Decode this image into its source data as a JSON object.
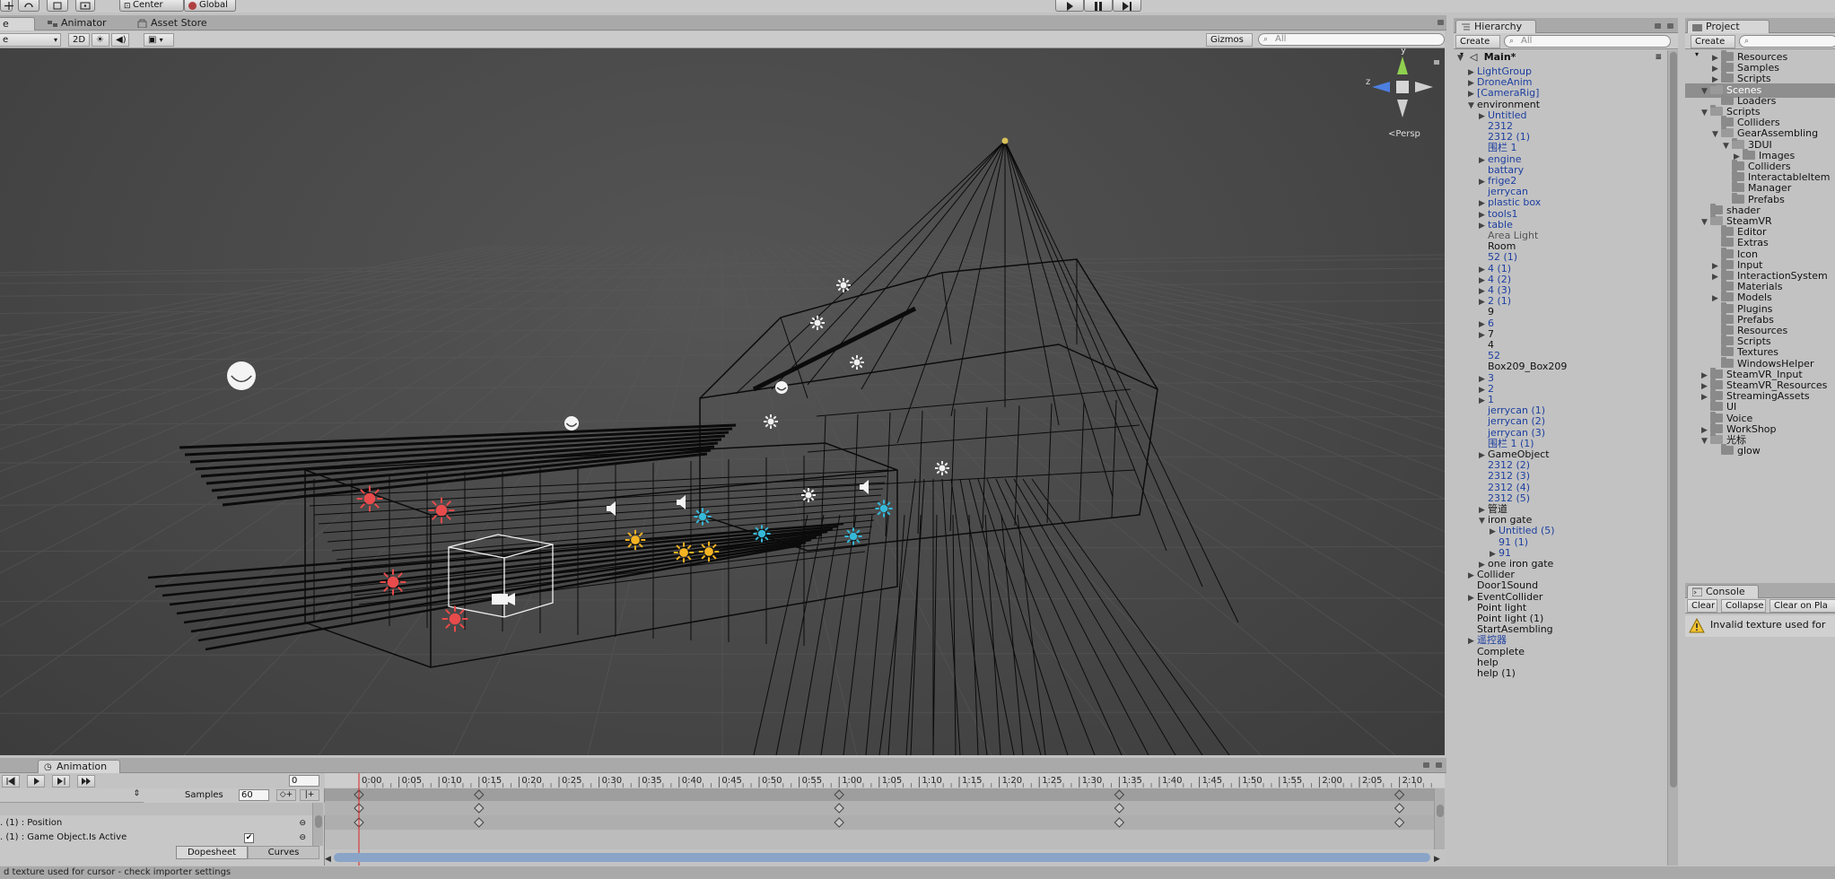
{
  "toolbar": {
    "pivot_center": "Center",
    "pivot_global": "Global"
  },
  "tabs": {
    "scene": "e",
    "animator": "Animator",
    "asset_store": "Asset Store"
  },
  "scene_toolbar": {
    "shading_mode": "e",
    "mode_2d": "2D",
    "gizmos": "Gizmos",
    "search_placeholder": "All",
    "persp_label": "Persp",
    "axis_y": "y",
    "axis_z": "z"
  },
  "animation": {
    "tab_label": "Animation",
    "frame_value": "0",
    "samples_label": "Samples",
    "samples_value": "60",
    "property_1": ". (1) : Position",
    "property_2": ". (1) : Game Object.Is Active",
    "dopesheet_tab": "Dopesheet",
    "curves_tab": "Curves",
    "timeline_ticks": [
      "0:00",
      "0:05",
      "0:10",
      "0:15",
      "0:20",
      "0:25",
      "0:30",
      "0:35",
      "0:40",
      "0:45",
      "0:50",
      "0:55",
      "1:00",
      "1:05",
      "1:10",
      "1:15",
      "1:20",
      "1:25",
      "1:30",
      "1:35",
      "1:40",
      "1:45",
      "1:50",
      "1:55",
      "2:00",
      "2:05",
      "2:10"
    ],
    "keyframe_ticks": [
      "0:00",
      "0:15",
      "1:00",
      "1:35",
      "2:10"
    ]
  },
  "hierarchy": {
    "tab_label": "Hierarchy",
    "create_label": "Create",
    "search_placeholder": "All",
    "scene_name": "Main*",
    "items": [
      {
        "label": "LightGroup",
        "indent": 1,
        "arrow": "closed",
        "color": "blue"
      },
      {
        "label": "DroneAnim",
        "indent": 1,
        "arrow": "closed",
        "color": "blue"
      },
      {
        "label": "[CameraRig]",
        "indent": 1,
        "arrow": "closed",
        "color": "blue"
      },
      {
        "label": "environment",
        "indent": 1,
        "arrow": "open",
        "color": "black"
      },
      {
        "label": "Untitled",
        "indent": 2,
        "arrow": "closed",
        "color": "blue"
      },
      {
        "label": "2312",
        "indent": 2,
        "arrow": "none",
        "color": "blue"
      },
      {
        "label": "2312 (1)",
        "indent": 2,
        "arrow": "none",
        "color": "blue"
      },
      {
        "label": "围栏 1",
        "indent": 2,
        "arrow": "none",
        "color": "blue"
      },
      {
        "label": "engine",
        "indent": 2,
        "arrow": "closed",
        "color": "blue"
      },
      {
        "label": "battary",
        "indent": 2,
        "arrow": "none",
        "color": "blue"
      },
      {
        "label": "frige2",
        "indent": 2,
        "arrow": "closed",
        "color": "blue"
      },
      {
        "label": "jerrycan",
        "indent": 2,
        "arrow": "none",
        "color": "blue"
      },
      {
        "label": "plastic box",
        "indent": 2,
        "arrow": "closed",
        "color": "blue"
      },
      {
        "label": "tools1",
        "indent": 2,
        "arrow": "closed",
        "color": "blue"
      },
      {
        "label": "table",
        "indent": 2,
        "arrow": "closed",
        "color": "blue"
      },
      {
        "label": "Area Light",
        "indent": 2,
        "arrow": "none",
        "color": "gray"
      },
      {
        "label": "Room",
        "indent": 2,
        "arrow": "none",
        "color": "black"
      },
      {
        "label": "52 (1)",
        "indent": 2,
        "arrow": "none",
        "color": "blue"
      },
      {
        "label": "4 (1)",
        "indent": 2,
        "arrow": "closed",
        "color": "blue"
      },
      {
        "label": "4 (2)",
        "indent": 2,
        "arrow": "closed",
        "color": "blue"
      },
      {
        "label": "4 (3)",
        "indent": 2,
        "arrow": "closed",
        "color": "blue"
      },
      {
        "label": "2 (1)",
        "indent": 2,
        "arrow": "closed",
        "color": "blue"
      },
      {
        "label": "9",
        "indent": 2,
        "arrow": "none",
        "color": "black"
      },
      {
        "label": "6",
        "indent": 2,
        "arrow": "closed",
        "color": "blue"
      },
      {
        "label": "7",
        "indent": 2,
        "arrow": "closed",
        "color": "black"
      },
      {
        "label": "4",
        "indent": 2,
        "arrow": "none",
        "color": "black"
      },
      {
        "label": "52",
        "indent": 2,
        "arrow": "none",
        "color": "blue"
      },
      {
        "label": "Box209_Box209",
        "indent": 2,
        "arrow": "none",
        "color": "black"
      },
      {
        "label": "3",
        "indent": 2,
        "arrow": "closed",
        "color": "blue"
      },
      {
        "label": "2",
        "indent": 2,
        "arrow": "closed",
        "color": "blue"
      },
      {
        "label": "1",
        "indent": 2,
        "arrow": "closed",
        "color": "blue"
      },
      {
        "label": "jerrycan (1)",
        "indent": 2,
        "arrow": "none",
        "color": "blue"
      },
      {
        "label": "jerrycan (2)",
        "indent": 2,
        "arrow": "none",
        "color": "blue"
      },
      {
        "label": "jerrycan (3)",
        "indent": 2,
        "arrow": "none",
        "color": "blue"
      },
      {
        "label": "围栏 1 (1)",
        "indent": 2,
        "arrow": "none",
        "color": "blue"
      },
      {
        "label": "GameObject",
        "indent": 2,
        "arrow": "closed",
        "color": "black"
      },
      {
        "label": "2312 (2)",
        "indent": 2,
        "arrow": "none",
        "color": "blue"
      },
      {
        "label": "2312 (3)",
        "indent": 2,
        "arrow": "none",
        "color": "blue"
      },
      {
        "label": "2312 (4)",
        "indent": 2,
        "arrow": "none",
        "color": "blue"
      },
      {
        "label": "2312 (5)",
        "indent": 2,
        "arrow": "none",
        "color": "blue"
      },
      {
        "label": "管道",
        "indent": 2,
        "arrow": "closed",
        "color": "black"
      },
      {
        "label": "iron gate",
        "indent": 2,
        "arrow": "open",
        "color": "black"
      },
      {
        "label": "Untitled (5)",
        "indent": 3,
        "arrow": "closed",
        "color": "blue"
      },
      {
        "label": "91 (1)",
        "indent": 3,
        "arrow": "none",
        "color": "blue"
      },
      {
        "label": "91",
        "indent": 3,
        "arrow": "closed",
        "color": "blue"
      },
      {
        "label": "one iron gate",
        "indent": 2,
        "arrow": "closed",
        "color": "black"
      },
      {
        "label": "Collider",
        "indent": 1,
        "arrow": "closed",
        "color": "black"
      },
      {
        "label": "Door1Sound",
        "indent": 1,
        "arrow": "none",
        "color": "black"
      },
      {
        "label": "EventCollider",
        "indent": 1,
        "arrow": "closed",
        "color": "black"
      },
      {
        "label": "Point light",
        "indent": 1,
        "arrow": "none",
        "color": "black"
      },
      {
        "label": "Point light (1)",
        "indent": 1,
        "arrow": "none",
        "color": "black"
      },
      {
        "label": "StartAsembling",
        "indent": 1,
        "arrow": "none",
        "color": "black"
      },
      {
        "label": "遥控器",
        "indent": 1,
        "arrow": "closed",
        "color": "blue"
      },
      {
        "label": "Complete",
        "indent": 1,
        "arrow": "none",
        "color": "black"
      },
      {
        "label": "help",
        "indent": 1,
        "arrow": "none",
        "color": "black"
      },
      {
        "label": "help (1)",
        "indent": 1,
        "arrow": "none",
        "color": "black"
      }
    ]
  },
  "project": {
    "tab_label": "Project",
    "create_label": "Create",
    "items": [
      {
        "label": "Resources",
        "indent": 2,
        "arrow": "closed"
      },
      {
        "label": "Samples",
        "indent": 2,
        "arrow": "closed"
      },
      {
        "label": "Scripts",
        "indent": 2,
        "arrow": "closed"
      },
      {
        "label": "Scenes",
        "indent": 1,
        "arrow": "open",
        "selected": true
      },
      {
        "label": "Loaders",
        "indent": 2,
        "arrow": "none"
      },
      {
        "label": "Scripts",
        "indent": 1,
        "arrow": "open"
      },
      {
        "label": "Colliders",
        "indent": 2,
        "arrow": "none"
      },
      {
        "label": "GearAssembling",
        "indent": 2,
        "arrow": "open"
      },
      {
        "label": "3DUI",
        "indent": 3,
        "arrow": "open"
      },
      {
        "label": "Images",
        "indent": 4,
        "arrow": "closed"
      },
      {
        "label": "Colliders",
        "indent": 3,
        "arrow": "none"
      },
      {
        "label": "InteractableItem",
        "indent": 3,
        "arrow": "none"
      },
      {
        "label": "Manager",
        "indent": 3,
        "arrow": "none"
      },
      {
        "label": "Prefabs",
        "indent": 3,
        "arrow": "none"
      },
      {
        "label": "shader",
        "indent": 1,
        "arrow": "none"
      },
      {
        "label": "SteamVR",
        "indent": 1,
        "arrow": "open"
      },
      {
        "label": "Editor",
        "indent": 2,
        "arrow": "none"
      },
      {
        "label": "Extras",
        "indent": 2,
        "arrow": "none"
      },
      {
        "label": "Icon",
        "indent": 2,
        "arrow": "none"
      },
      {
        "label": "Input",
        "indent": 2,
        "arrow": "closed"
      },
      {
        "label": "InteractionSystem",
        "indent": 2,
        "arrow": "closed"
      },
      {
        "label": "Materials",
        "indent": 2,
        "arrow": "none"
      },
      {
        "label": "Models",
        "indent": 2,
        "arrow": "closed"
      },
      {
        "label": "Plugins",
        "indent": 2,
        "arrow": "none"
      },
      {
        "label": "Prefabs",
        "indent": 2,
        "arrow": "none"
      },
      {
        "label": "Resources",
        "indent": 2,
        "arrow": "none"
      },
      {
        "label": "Scripts",
        "indent": 2,
        "arrow": "none"
      },
      {
        "label": "Textures",
        "indent": 2,
        "arrow": "none"
      },
      {
        "label": "WindowsHelper",
        "indent": 2,
        "arrow": "none"
      },
      {
        "label": "SteamVR_Input",
        "indent": 1,
        "arrow": "closed"
      },
      {
        "label": "SteamVR_Resources",
        "indent": 1,
        "arrow": "closed"
      },
      {
        "label": "StreamingAssets",
        "indent": 1,
        "arrow": "closed"
      },
      {
        "label": "UI",
        "indent": 1,
        "arrow": "none"
      },
      {
        "label": "Voice",
        "indent": 1,
        "arrow": "none"
      },
      {
        "label": "WorkShop",
        "indent": 1,
        "arrow": "closed"
      },
      {
        "label": "光标",
        "indent": 1,
        "arrow": "open"
      },
      {
        "label": "glow",
        "indent": 2,
        "arrow": "none"
      }
    ]
  },
  "console": {
    "tab_label": "Console",
    "clear": "Clear",
    "collapse": "Collapse",
    "clear_on_play": "Clear on Pla",
    "message": "Invalid texture used for"
  },
  "status_bar": {
    "message": "d texture used for cursor - check importer settings"
  },
  "colors": {
    "light_red": "#e84b4b",
    "light_yellow": "#f2b323",
    "light_cyan": "#36b8d8",
    "hierarchy_blue": "#1d3fa0"
  }
}
